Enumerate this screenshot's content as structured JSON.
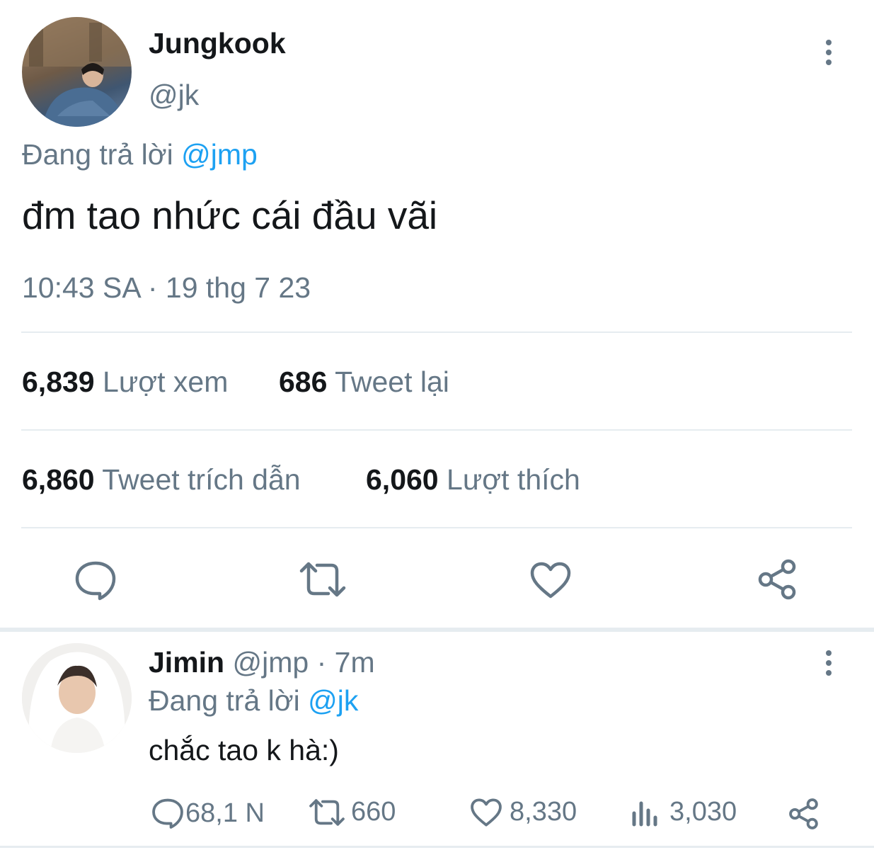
{
  "main_tweet": {
    "author_name": "Jungkook",
    "handle": "@jk",
    "reply_prefix": "Đang trả lời",
    "reply_to": "@jmp",
    "text": "đm tao nhức cái đầu vãi",
    "time": "10:43 SA",
    "date": "19 thg 7 23",
    "separator": "·",
    "stats": {
      "views_count": "6,839",
      "views_label": "Lượt xem",
      "retweets_count": "686",
      "retweets_label": "Tweet lại",
      "quotes_count": "6,860",
      "quotes_label": "Tweet trích dẫn",
      "likes_count": "6,060",
      "likes_label": "Lượt thích"
    },
    "actions": [
      "reply-icon",
      "retweet-icon",
      "like-icon",
      "share-icon"
    ]
  },
  "reply_tweet": {
    "author_name": "Jimin",
    "handle": "@jmp",
    "separator": "·",
    "time_ago": "7m",
    "reply_prefix": "Đang trả lời",
    "reply_to": "@jk",
    "text": "chắc tao k hà:)",
    "counts": {
      "replies": "68,1 N",
      "retweets": "660",
      "likes": "8,330",
      "views": "3,030"
    }
  },
  "colors": {
    "accent": "#1da1f2",
    "secondary_text": "#657786",
    "divider": "#e6ecf0"
  }
}
